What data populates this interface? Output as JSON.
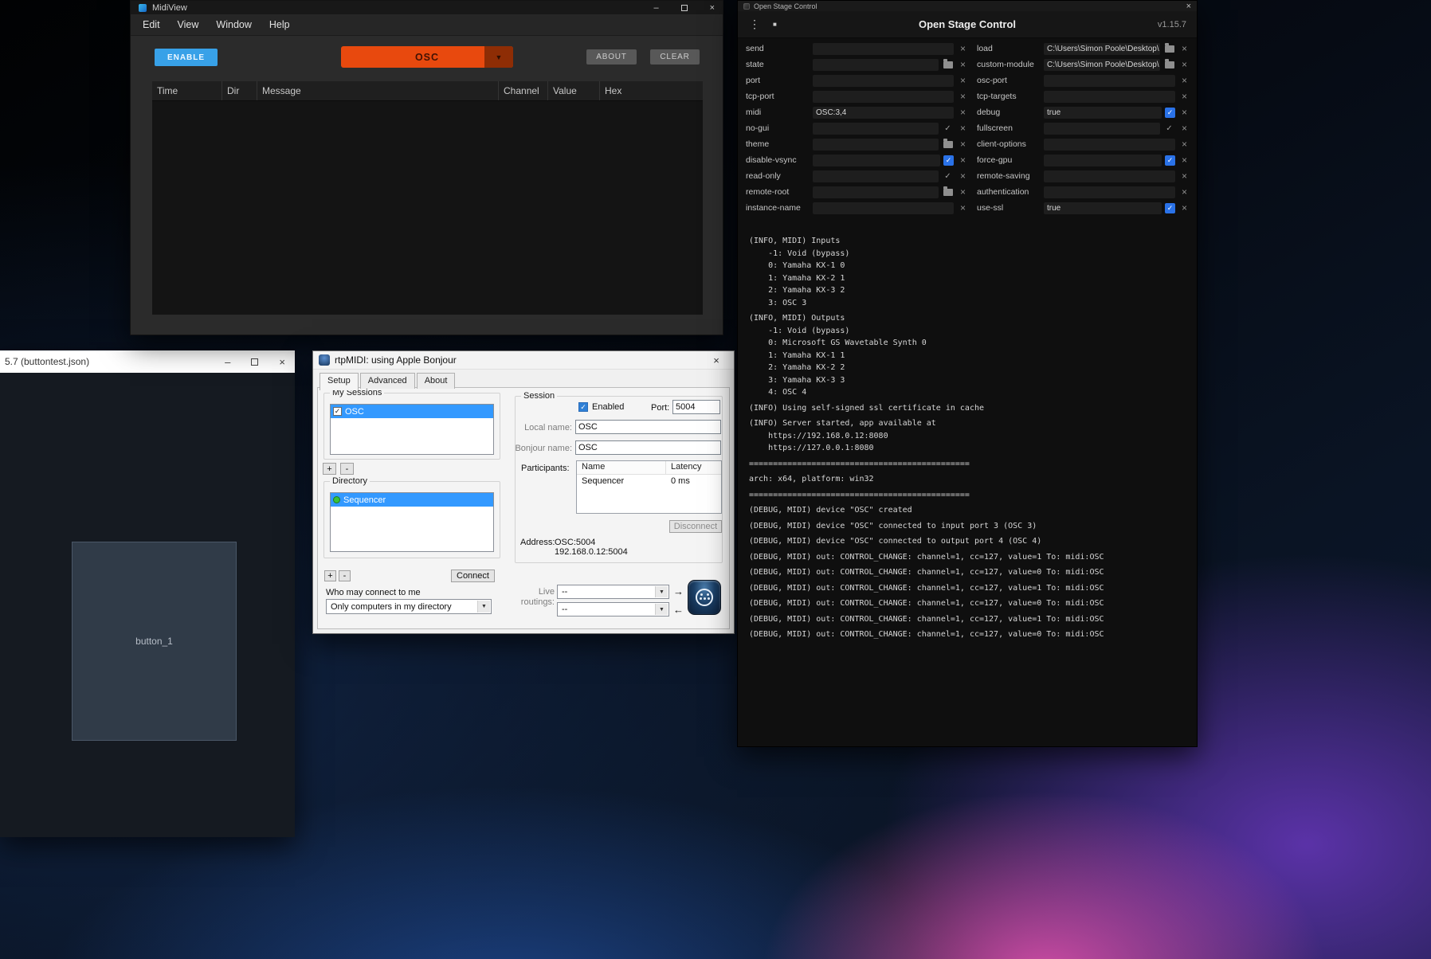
{
  "client": {
    "title": "5.7 (buttontest.json)",
    "button_label": "button_1"
  },
  "midiview": {
    "title": "MidiView",
    "menu": [
      "Edit",
      "View",
      "Window",
      "Help"
    ],
    "enable_button": "ENABLE",
    "mode_dropdown": "OSC",
    "about_button": "ABOUT",
    "clear_button": "CLEAR",
    "table_headers": [
      "Time",
      "Dir",
      "Message",
      "Channel",
      "Value",
      "Hex"
    ]
  },
  "osc": {
    "window_title": "Open Stage Control",
    "header_title": "Open Stage Control",
    "version": "v1.15.7",
    "fields_left": [
      {
        "label": "send",
        "value": "",
        "icons": [
          "x"
        ]
      },
      {
        "label": "state",
        "value": "",
        "icons": [
          "folder",
          "x"
        ]
      },
      {
        "label": "port",
        "value": "",
        "icons": [
          "x"
        ]
      },
      {
        "label": "tcp-port",
        "value": "",
        "icons": [
          "x"
        ]
      },
      {
        "label": "midi",
        "value": "OSC:3,4",
        "icons": [
          "x"
        ]
      },
      {
        "label": "no-gui",
        "value": "",
        "icons": [
          "check",
          "x"
        ]
      },
      {
        "label": "theme",
        "value": "",
        "icons": [
          "folder",
          "x"
        ]
      },
      {
        "label": "disable-vsync",
        "value": "",
        "icons": [
          "check-on",
          "x"
        ]
      },
      {
        "label": "read-only",
        "value": "",
        "icons": [
          "check",
          "x"
        ]
      },
      {
        "label": "remote-root",
        "value": "",
        "icons": [
          "folder",
          "x"
        ]
      },
      {
        "label": "instance-name",
        "value": "",
        "icons": [
          "x"
        ]
      }
    ],
    "fields_right": [
      {
        "label": "load",
        "value": "C:\\Users\\Simon Poole\\Desktop\\",
        "icons": [
          "folder",
          "x"
        ]
      },
      {
        "label": "custom-module",
        "value": "C:\\Users\\Simon Poole\\Desktop\\",
        "icons": [
          "folder",
          "x"
        ]
      },
      {
        "label": "osc-port",
        "value": "",
        "icons": [
          "x"
        ]
      },
      {
        "label": "tcp-targets",
        "value": "",
        "icons": [
          "x"
        ]
      },
      {
        "label": "debug",
        "value": "true",
        "icons": [
          "check-on",
          "x"
        ]
      },
      {
        "label": "fullscreen",
        "value": "",
        "icons": [
          "check",
          "x"
        ]
      },
      {
        "label": "client-options",
        "value": "",
        "icons": [
          "x"
        ]
      },
      {
        "label": "force-gpu",
        "value": "",
        "icons": [
          "check-on",
          "x"
        ]
      },
      {
        "label": "remote-saving",
        "value": "",
        "icons": [
          "x"
        ]
      },
      {
        "label": "authentication",
        "value": "",
        "icons": [
          "x"
        ]
      },
      {
        "label": "use-ssl",
        "value": "true",
        "icons": [
          "check-on",
          "x"
        ]
      }
    ],
    "console": [
      [
        "(INFO, MIDI) Inputs",
        "    -1: Void (bypass)",
        "    0: Yamaha KX-1 0",
        "    1: Yamaha KX-2 1",
        "    2: Yamaha KX-3 2",
        "    3: OSC 3"
      ],
      [
        "(INFO, MIDI) Outputs",
        "    -1: Void (bypass)",
        "    0: Microsoft GS Wavetable Synth 0",
        "    1: Yamaha KX-1 1",
        "    2: Yamaha KX-2 2",
        "    3: Yamaha KX-3 3",
        "    4: OSC 4"
      ],
      [
        "(INFO) Using self-signed ssl certificate in cache"
      ],
      [
        "(INFO) Server started, app available at",
        "    https://192.168.0.12:8080",
        "    https://127.0.0.1:8080"
      ],
      [
        "=============================================="
      ],
      [
        "arch: x64, platform: win32"
      ],
      [
        "=============================================="
      ],
      [
        "(DEBUG, MIDI) device \"OSC\" created"
      ],
      [
        "(DEBUG, MIDI) device \"OSC\" connected to input port 3 (OSC 3)"
      ],
      [
        "(DEBUG, MIDI) device \"OSC\" connected to output port 4 (OSC 4)"
      ],
      [
        "(DEBUG, MIDI) out: CONTROL_CHANGE: channel=1, cc=127, value=1 To: midi:OSC"
      ],
      [
        "(DEBUG, MIDI) out: CONTROL_CHANGE: channel=1, cc=127, value=0 To: midi:OSC"
      ],
      [
        "(DEBUG, MIDI) out: CONTROL_CHANGE: channel=1, cc=127, value=1 To: midi:OSC"
      ],
      [
        "(DEBUG, MIDI) out: CONTROL_CHANGE: channel=1, cc=127, value=0 To: midi:OSC"
      ],
      [
        "(DEBUG, MIDI) out: CONTROL_CHANGE: channel=1, cc=127, value=1 To: midi:OSC"
      ],
      [
        "(DEBUG, MIDI) out: CONTROL_CHANGE: channel=1, cc=127, value=0 To: midi:OSC"
      ]
    ]
  },
  "rtpmidi": {
    "title": "rtpMIDI: using Apple Bonjour",
    "tabs": [
      "Setup",
      "Advanced",
      "About"
    ],
    "my_sessions_label": "My Sessions",
    "session_item_label": "OSC",
    "directory_label": "Directory",
    "directory_item_label": "Sequencer",
    "add_label": "+",
    "remove_label": "-",
    "connect_button": "Connect",
    "who_label": "Who may connect to me",
    "who_value": "Only computers in my directory",
    "session_label": "Session",
    "enabled_label": "Enabled",
    "port_label": "Port:",
    "port_value": "5004",
    "local_name_label": "Local name:",
    "local_name_value": "OSC",
    "bonjour_name_label": "Bonjour name:",
    "bonjour_name_value": "OSC",
    "participants_label": "Participants:",
    "participants_columns": [
      "Name",
      "Latency"
    ],
    "participants_rows": [
      [
        "Sequencer",
        "0 ms"
      ]
    ],
    "disconnect_button": "Disconnect",
    "address_label": "Address:",
    "address_value1": "OSC:5004",
    "address_value2": "192.168.0.12:5004",
    "live_routings_label": "Live routings:",
    "routing_value_top": "--",
    "routing_value_bottom": "--"
  },
  "colors": {
    "enable_blue": "#38a1e8",
    "osc_orange": "#e8490e",
    "selection_blue": "#3399ff",
    "checkbox_blue": "#2a72e8"
  }
}
